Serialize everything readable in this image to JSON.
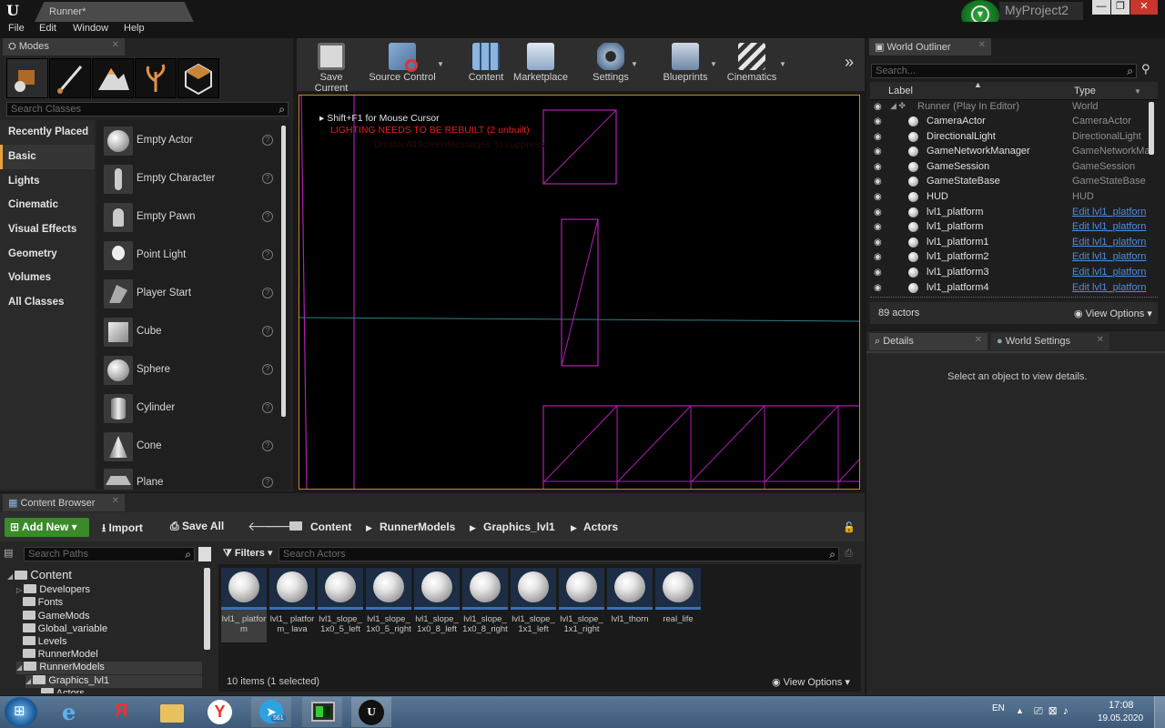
{
  "window": {
    "doc_tab": "Runner*",
    "project": "MyProject2",
    "minimize": "—",
    "restore": "❐",
    "close": "✕"
  },
  "menu": [
    "File",
    "Edit",
    "Window",
    "Help"
  ],
  "modes": {
    "tab": "Modes",
    "search_placeholder": "Search Classes",
    "categories": [
      "Recently Placed",
      "Basic",
      "Lights",
      "Cinematic",
      "Visual Effects",
      "Geometry",
      "Volumes",
      "All Classes"
    ],
    "selected_category": "Basic",
    "actors": [
      "Empty Actor",
      "Empty Character",
      "Empty Pawn",
      "Point Light",
      "Player Start",
      "Cube",
      "Sphere",
      "Cylinder",
      "Cone",
      "Plane"
    ]
  },
  "toolbar": [
    "Save Current",
    "Source Control",
    "Content",
    "Marketplace",
    "Settings",
    "Blueprints",
    "Cinematics"
  ],
  "viewport": {
    "hint": "Shift+F1 for Mouse Cursor",
    "warning": "LIGHTING NEEDS TO BE REBUILT (2 unbuilt)",
    "warning_sub": "'DisableAllScreenMessages' to suppress"
  },
  "outliner": {
    "tab": "World Outliner",
    "search_placeholder": "Search...",
    "col_label": "Label",
    "col_type": "Type",
    "root": {
      "name": "Runner (Play In Editor)",
      "type": "World"
    },
    "rows": [
      {
        "name": "CameraActor",
        "type": "CameraActor",
        "link": false
      },
      {
        "name": "DirectionalLight",
        "type": "DirectionalLight",
        "link": false
      },
      {
        "name": "GameNetworkManager",
        "type": "GameNetworkMa",
        "link": false
      },
      {
        "name": "GameSession",
        "type": "GameSession",
        "link": false
      },
      {
        "name": "GameStateBase",
        "type": "GameStateBase",
        "link": false
      },
      {
        "name": "HUD",
        "type": "HUD",
        "link": false
      },
      {
        "name": "lvl1_platform",
        "type": "Edit lvl1_platforn",
        "link": true
      },
      {
        "name": "lvl1_platform",
        "type": "Edit lvl1_platforn",
        "link": true
      },
      {
        "name": "lvl1_platform1",
        "type": "Edit lvl1_platforn",
        "link": true
      },
      {
        "name": "lvl1_platform2",
        "type": "Edit lvl1_platforn",
        "link": true
      },
      {
        "name": "lvl1_platform3",
        "type": "Edit lvl1_platforn",
        "link": true
      },
      {
        "name": "lvl1_platform4",
        "type": "Edit lvl1_platforn",
        "link": true
      }
    ],
    "count": "89 actors",
    "view_options": "View Options"
  },
  "details": {
    "tab": "Details",
    "tab2": "World Settings",
    "empty": "Select an object to view details."
  },
  "content_browser": {
    "tab": "Content Browser",
    "add_new": "Add New",
    "import": "Import",
    "save_all": "Save All",
    "breadcrumb": [
      "Content",
      "RunnerModels",
      "Graphics_lvl1",
      "Actors"
    ],
    "search_paths": "Search Paths",
    "filters": "Filters",
    "search_assets": "Search Actors",
    "tree": [
      {
        "name": "Content",
        "indent": 0
      },
      {
        "name": "Developers",
        "indent": 1
      },
      {
        "name": "Fonts",
        "indent": 1
      },
      {
        "name": "GameMods",
        "indent": 1
      },
      {
        "name": "Global_variable",
        "indent": 1
      },
      {
        "name": "Levels",
        "indent": 1
      },
      {
        "name": "RunnerModel",
        "indent": 1
      },
      {
        "name": "RunnerModels",
        "indent": 1
      },
      {
        "name": "Graphics_lvl1",
        "indent": 2
      },
      {
        "name": "Actors",
        "indent": 3
      }
    ],
    "assets": [
      "lvl1_ platform",
      "lvl1_ platform_ lava",
      "lvl1_slope_ 1x0_5_left",
      "lvl1_slope_ 1x0_5_right",
      "lvl1_slope_ 1x0_8_left",
      "lvl1_slope_ 1x0_8_right",
      "lvl1_slope_ 1x1_left",
      "lvl1_slope_ 1x1_right",
      "lvl1_thorn",
      "real_life"
    ],
    "status": "10 items (1 selected)",
    "view_options": "View Options"
  },
  "taskbar": {
    "lang": "EN",
    "time": "17:08",
    "date": "19.05.2020",
    "telegram_badge": "561"
  }
}
